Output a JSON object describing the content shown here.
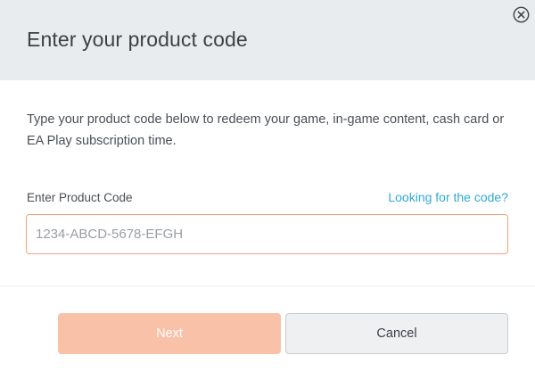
{
  "dialog": {
    "title": "Enter your product code",
    "close_icon": "close-circle-icon"
  },
  "body": {
    "description": "Type your product code below to redeem your game, in-game content, cash card or EA Play subscription time.",
    "field_label": "Enter Product Code",
    "help_link": "Looking for the code?",
    "input_value": "",
    "input_placeholder": "1234-ABCD-5678-EFGH"
  },
  "footer": {
    "next_label": "Next",
    "cancel_label": "Cancel"
  },
  "colors": {
    "header_bg": "#e9ecee",
    "accent_link": "#2fa9d6",
    "input_border": "#f3a27c",
    "next_disabled_bg": "#f8c1a8"
  }
}
